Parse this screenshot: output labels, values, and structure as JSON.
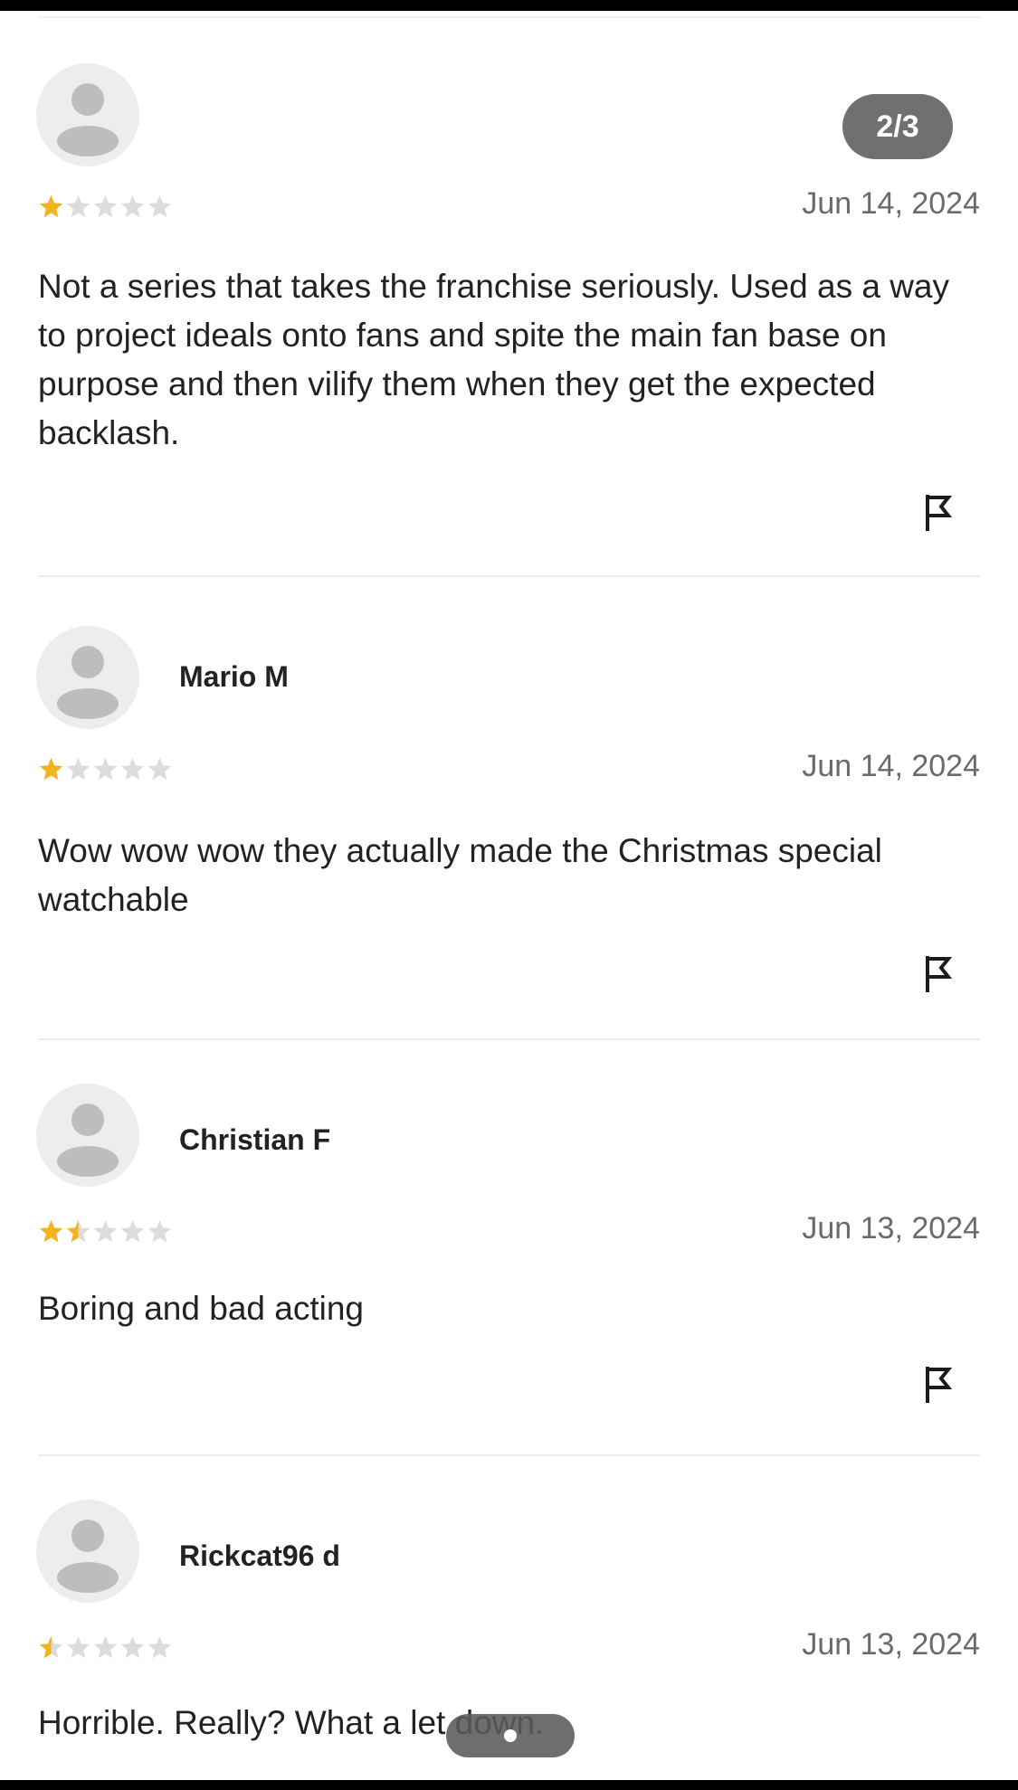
{
  "counter": {
    "label": "2/3"
  },
  "colors": {
    "star_filled": "#f3b41b",
    "star_empty": "#dcdcdc",
    "badge_bg": "#707070",
    "divider": "#ececec"
  },
  "icons": {
    "avatar": "avatar-placeholder-icon",
    "star": "star-icon",
    "flag": "flag-icon"
  },
  "reviews": [
    {
      "name": "",
      "rating": 1,
      "rating_max": 5,
      "date": "Jun 14, 2024",
      "text": "Not a series that takes the franchise seriously. Used as a way to project ideals onto fans and spite the main fan base on purpose and then vilify them when they get the expected backlash."
    },
    {
      "name": "Mario M",
      "rating": 1,
      "rating_max": 5,
      "date": "Jun 14, 2024",
      "text": "Wow wow wow they actually made the Christmas special watchable"
    },
    {
      "name": "Christian F",
      "rating": 1.5,
      "rating_max": 5,
      "date": "Jun 13, 2024",
      "text": "Boring and bad acting"
    },
    {
      "name": "Rickcat96 d",
      "rating": 0.5,
      "rating_max": 5,
      "date": "Jun 13, 2024",
      "text": "Horrible. Really? What a let down."
    }
  ]
}
